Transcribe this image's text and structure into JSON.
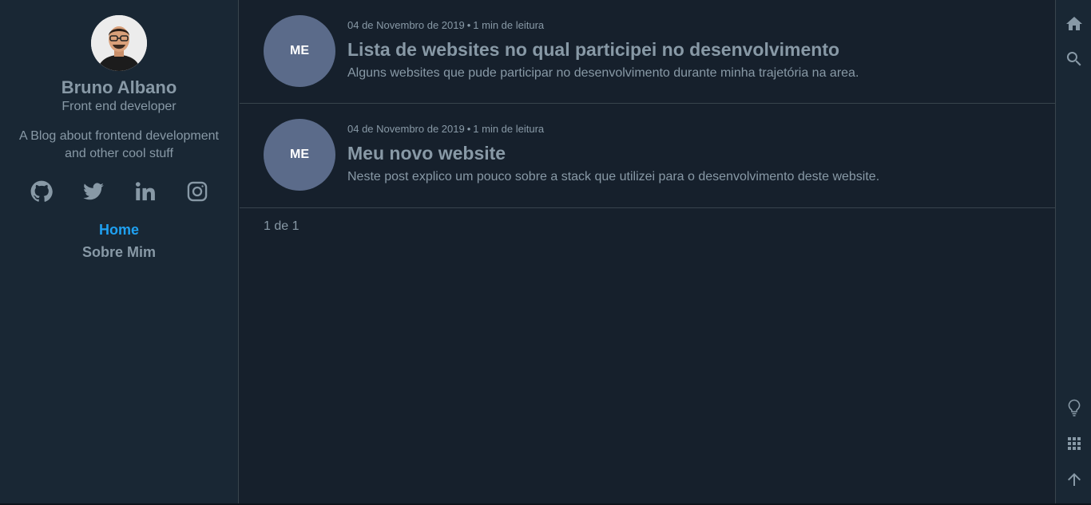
{
  "profile": {
    "name": "Bruno Albano",
    "role": "Front end developer",
    "description": "A Blog about frontend development and other cool stuff"
  },
  "socials": [
    {
      "icon": "github-icon"
    },
    {
      "icon": "twitter-icon"
    },
    {
      "icon": "linkedin-icon"
    },
    {
      "icon": "instagram-icon"
    }
  ],
  "nav": {
    "items": [
      {
        "label": "Home",
        "active": true
      },
      {
        "label": "Sobre Mim",
        "active": false
      }
    ]
  },
  "posts": [
    {
      "tag": "ME",
      "date": "04 de Novembro de 2019",
      "read_time": "1 min de leitura",
      "title": "Lista de websites no qual participei no desenvolvimento",
      "excerpt": "Alguns websites que pude participar no desenvolvimento durante minha trajetória na area."
    },
    {
      "tag": "ME",
      "date": "04 de Novembro de 2019",
      "read_time": "1 min de leitura",
      "title": "Meu novo website",
      "excerpt": "Neste post explico um pouco sobre a stack que utilizei para o desenvolvimento deste website."
    }
  ],
  "pagination": {
    "text": "1 de 1"
  },
  "colors": {
    "background": "#16202c",
    "sidebar": "#192734",
    "text": "#8899a6",
    "accent": "#1fa1f2",
    "tag": "#5b6b8a"
  },
  "rightbar": {
    "icons": [
      "home-icon",
      "search-icon",
      "lightbulb-icon",
      "grid-icon",
      "arrow-up-icon"
    ]
  }
}
